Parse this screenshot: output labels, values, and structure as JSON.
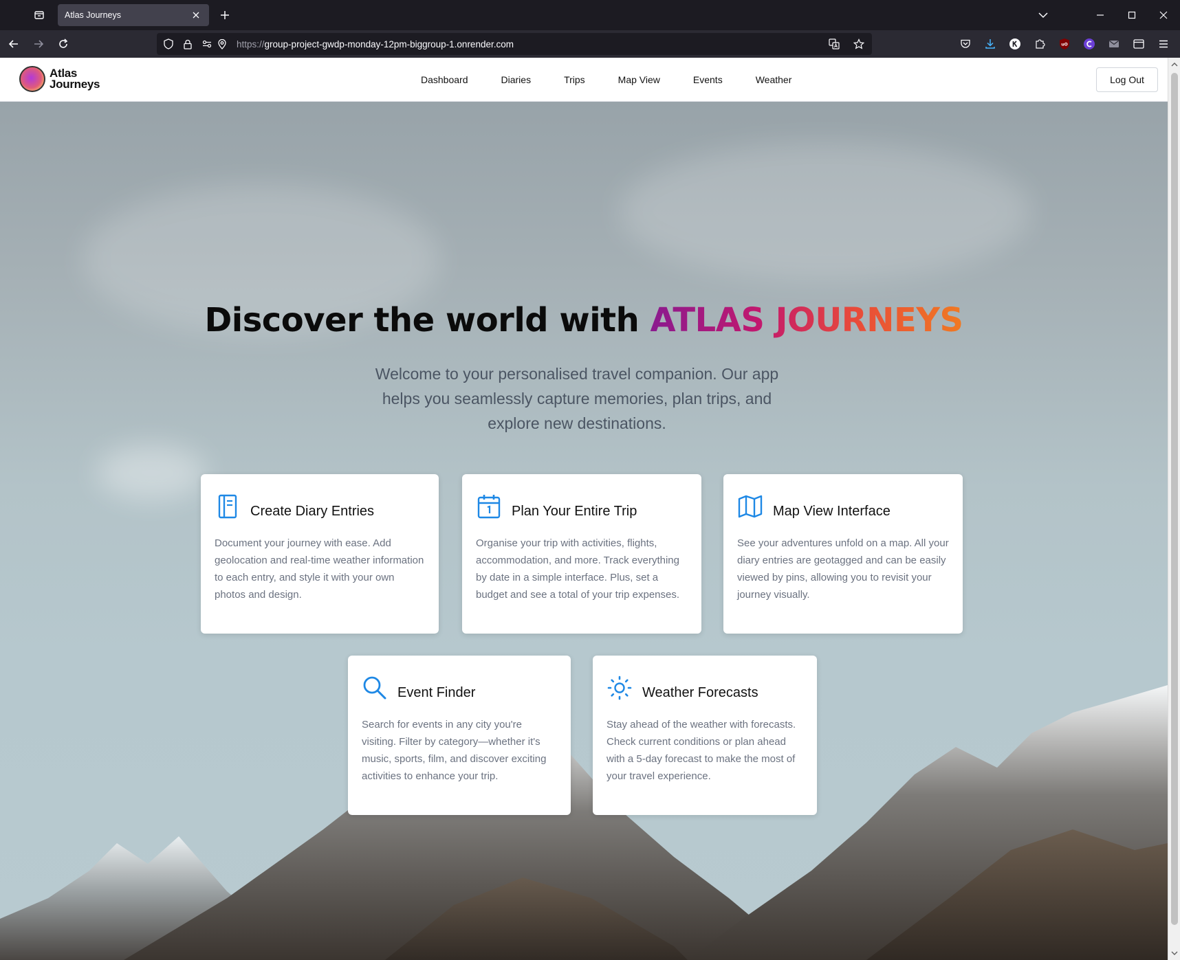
{
  "browser": {
    "tab_title": "Atlas Journeys",
    "url_proto": "https://",
    "url_host": "group-project-gwdp-monday-12pm-biggroup-1.onrender.com"
  },
  "site": {
    "logo_line1": "Atlas",
    "logo_line2": "Journeys",
    "nav": [
      "Dashboard",
      "Diaries",
      "Trips",
      "Map View",
      "Events",
      "Weather"
    ],
    "logout_label": "Log Out"
  },
  "hero": {
    "headline_prefix": "Discover the world with ",
    "headline_brand": "ATLAS JOURNEYS",
    "subtext": "Welcome to your personalised travel companion. Our app helps you seamlessly capture memories, plan trips, and explore new destinations."
  },
  "features": [
    {
      "title": "Create Diary Entries",
      "icon": "notebook-icon",
      "body": "Document your journey with ease. Add geolocation and real-time weather information to each entry, and style it with your own photos and design."
    },
    {
      "title": "Plan Your Entire Trip",
      "icon": "calendar-icon",
      "body": "Organise your trip with activities, flights, accommodation, and more. Track everything by date in a simple interface. Plus, set a budget and see a total of your trip expenses."
    },
    {
      "title": "Map View Interface",
      "icon": "map-icon",
      "body": "See your adventures unfold on a map. All your diary entries are geotagged and can be easily viewed by pins, allowing you to revisit your journey visually."
    },
    {
      "title": "Event Finder",
      "icon": "search-icon",
      "body": "Search for events in any city you're visiting. Filter by category—whether it's music, sports, film, and discover exciting activities to enhance your trip."
    },
    {
      "title": "Weather Forecasts",
      "icon": "sun-icon",
      "body": "Stay ahead of the weather with forecasts. Check current conditions or plan ahead with a 5-day forecast to make the most of your travel experience."
    }
  ],
  "colors": {
    "accent_icon": "#1e88e5",
    "brand_gradient_start": "#8a1b8f",
    "brand_gradient_end": "#f07a22"
  }
}
